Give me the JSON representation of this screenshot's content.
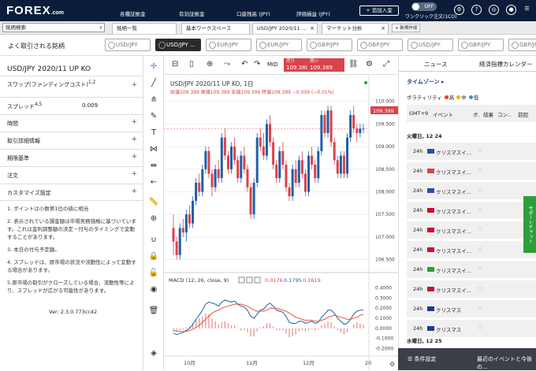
{
  "header": {
    "logo": "FOREX",
    "logo_suffix": ".com",
    "links": [
      "各種証拠金",
      "有効証拠金",
      "口座残高 (JPY)",
      "評価損益 (JPY)"
    ],
    "fund_button": "+ 追加入金",
    "toggle": "OFF",
    "oneclick": "ワンクリック注文(1CO)"
  },
  "tabs": {
    "search_placeholder": "銘柄検索",
    "items": [
      {
        "label": "銘柄一覧"
      },
      {
        "label": "基本ワークスペース"
      },
      {
        "label": "USD/JPY 2020/11 ..."
      },
      {
        "label": "マーケット分析"
      }
    ],
    "new_tab": "+ 新規作成"
  },
  "pairs": {
    "favorites": "よく取引される銘柄",
    "items": [
      "USD/JPY",
      "USD/JPY ...",
      "EUR/JPY",
      "EUR/JPY",
      "GBP/JPY",
      "GBP/JPY"
    ]
  },
  "left": {
    "title": "USD/JPY 2020/11 UP KO",
    "swap_label": "スワップ(ファンディングコスト)",
    "swap_sup": "1,2",
    "spread_label": "スプレッド",
    "spread_sup": "4,5",
    "spread_value": "0.009",
    "sections": [
      "時間",
      "取引詳細情報",
      "期限基準",
      "注文",
      "カスタマイズ設定"
    ],
    "notes": [
      "1. ポイントは小数第1位の値に相当",
      "2. 表示されている課金額は市場実務価格に基づいています。これは金利調整額の決定・付与のタイミングで変動することがあります。",
      "3. 本日の付与予定額。",
      "4. スプレッドは、原市場の状況や流動性によって変動する場合があります。",
      "5.原市場の取引がクローズしている場合、流動性等により、スプレッドが広がる可能性があります。"
    ],
    "version": "Ver: 2.3.0.773cc42"
  },
  "toolbar": {
    "mid": "MID",
    "sell_label": "売り",
    "sell_price": "109.380",
    "buy_label": "買い",
    "buy_price": "109.389"
  },
  "chart": {
    "title": "USD/JPY 2020/11 UP KO, 1日",
    "ohlc": "始値109.399 高値109.399 安値109.399 終値109.399 −0.009 (−0.01%)",
    "last_price": "109.399",
    "yticks": [
      "110.000",
      "109.500",
      "109.000",
      "108.500",
      "108.000",
      "107.500",
      "107.000",
      "106.500"
    ],
    "macd_label": "MACD (12, 26, close, 9)",
    "macd_vals": [
      "0.0176",
      "0.1795",
      "0.1619"
    ],
    "macd_yticks": [
      "0.4000",
      "0.3000",
      "0.2000",
      "0.1000",
      "0.0000",
      "-0.1000",
      "-0.2000"
    ],
    "xticks": [
      "10月",
      "11月",
      "12月",
      "20"
    ]
  },
  "chart_data": {
    "type": "candlestick",
    "title": "USD/JPY 2020/11 UP KO, 1日",
    "ylim": [
      106.3,
      110.1
    ],
    "candles": [
      [
        107.2,
        107.5,
        106.6,
        106.9
      ],
      [
        106.9,
        107.0,
        106.5,
        106.6
      ],
      [
        106.6,
        107.3,
        106.5,
        107.2
      ],
      [
        107.2,
        107.4,
        107.0,
        107.1
      ],
      [
        107.1,
        107.6,
        106.9,
        107.5
      ],
      [
        107.5,
        107.7,
        107.2,
        107.3
      ],
      [
        107.3,
        107.9,
        107.2,
        107.8
      ],
      [
        107.8,
        108.3,
        107.7,
        108.2
      ],
      [
        108.2,
        108.4,
        107.9,
        108.0
      ],
      [
        108.0,
        108.6,
        107.9,
        108.5
      ],
      [
        108.5,
        109.0,
        108.4,
        108.9
      ],
      [
        108.9,
        109.0,
        108.3,
        108.4
      ],
      [
        108.4,
        108.5,
        107.9,
        108.1
      ],
      [
        108.1,
        108.6,
        108.0,
        108.5
      ],
      [
        108.5,
        108.7,
        108.2,
        108.3
      ],
      [
        108.3,
        109.3,
        108.2,
        109.2
      ],
      [
        109.2,
        109.4,
        108.7,
        108.8
      ],
      [
        108.8,
        108.9,
        108.4,
        108.5
      ],
      [
        108.5,
        109.1,
        108.4,
        109.0
      ],
      [
        109.0,
        109.2,
        108.6,
        108.7
      ],
      [
        108.7,
        108.8,
        108.2,
        108.3
      ],
      [
        108.3,
        108.9,
        108.2,
        108.8
      ],
      [
        108.8,
        109.0,
        108.4,
        108.5
      ],
      [
        108.5,
        108.6,
        108.0,
        108.1
      ],
      [
        108.1,
        108.2,
        107.4,
        107.5
      ],
      [
        107.5,
        108.3,
        107.4,
        108.2
      ],
      [
        108.2,
        109.3,
        108.1,
        109.2
      ],
      [
        109.2,
        109.4,
        108.9,
        109.0
      ],
      [
        109.0,
        109.3,
        108.7,
        108.8
      ],
      [
        108.8,
        109.6,
        108.7,
        109.5
      ],
      [
        109.5,
        109.7,
        109.0,
        109.1
      ],
      [
        109.1,
        109.2,
        108.5,
        108.6
      ],
      [
        108.6,
        108.7,
        108.2,
        108.3
      ],
      [
        108.3,
        109.0,
        108.2,
        108.9
      ],
      [
        108.9,
        109.1,
        108.5,
        108.6
      ],
      [
        108.6,
        108.7,
        108.0,
        108.1
      ],
      [
        108.1,
        108.2,
        107.8,
        107.9
      ],
      [
        107.9,
        108.6,
        107.8,
        108.5
      ],
      [
        108.5,
        108.7,
        108.1,
        108.2
      ],
      [
        108.2,
        108.8,
        108.1,
        108.7
      ],
      [
        108.7,
        108.9,
        108.3,
        108.4
      ],
      [
        108.4,
        108.5,
        107.9,
        108.0
      ],
      [
        108.0,
        108.9,
        107.9,
        108.8
      ],
      [
        108.8,
        109.0,
        108.5,
        108.6
      ],
      [
        108.6,
        108.7,
        108.2,
        108.3
      ],
      [
        108.3,
        109.0,
        108.2,
        108.9
      ],
      [
        108.9,
        109.8,
        108.8,
        109.7
      ],
      [
        109.7,
        109.8,
        109.2,
        109.3
      ],
      [
        109.3,
        109.9,
        109.2,
        109.8
      ],
      [
        109.8,
        109.9,
        109.0,
        109.1
      ],
      [
        109.1,
        109.2,
        108.6,
        108.7
      ],
      [
        108.7,
        108.8,
        108.3,
        108.4
      ],
      [
        108.4,
        108.9,
        108.3,
        108.8
      ],
      [
        108.8,
        108.9,
        108.3,
        108.4
      ],
      [
        108.4,
        109.3,
        108.3,
        109.2
      ],
      [
        109.2,
        109.8,
        109.1,
        109.7
      ],
      [
        109.7,
        109.9,
        109.3,
        109.4
      ],
      [
        109.4,
        109.5,
        109.1,
        109.3
      ],
      [
        109.3,
        109.5,
        109.2,
        109.4
      ],
      [
        109.4,
        109.5,
        109.3,
        109.4
      ]
    ],
    "macd_ylim": [
      -0.25,
      0.42
    ],
    "macd": [
      -0.05,
      -0.06,
      -0.05,
      -0.04,
      -0.02,
      0.0,
      0.04,
      0.09,
      0.13,
      0.18,
      0.24,
      0.26,
      0.25,
      0.24,
      0.22,
      0.26,
      0.28,
      0.27,
      0.26,
      0.27,
      0.24,
      0.22,
      0.21,
      0.18,
      0.12,
      0.1,
      0.14,
      0.18,
      0.19,
      0.23,
      0.25,
      0.22,
      0.18,
      0.17,
      0.16,
      0.12,
      0.06,
      0.05,
      0.05,
      0.07,
      0.07,
      0.05,
      0.06,
      0.07,
      0.05,
      0.06,
      0.11,
      0.14,
      0.18,
      0.18,
      0.15,
      0.1,
      0.07,
      0.04,
      0.05,
      0.09,
      0.14,
      0.17,
      0.18,
      0.18
    ],
    "signal": [
      -0.02,
      -0.03,
      -0.03,
      -0.03,
      -0.03,
      -0.02,
      -0.01,
      0.01,
      0.03,
      0.06,
      0.09,
      0.12,
      0.15,
      0.17,
      0.18,
      0.2,
      0.21,
      0.22,
      0.23,
      0.24,
      0.24,
      0.24,
      0.23,
      0.22,
      0.2,
      0.18,
      0.17,
      0.17,
      0.17,
      0.18,
      0.2,
      0.2,
      0.2,
      0.19,
      0.18,
      0.17,
      0.15,
      0.13,
      0.11,
      0.1,
      0.09,
      0.08,
      0.08,
      0.08,
      0.07,
      0.07,
      0.08,
      0.09,
      0.11,
      0.12,
      0.13,
      0.12,
      0.11,
      0.1,
      0.09,
      0.09,
      0.1,
      0.11,
      0.13,
      0.14
    ]
  },
  "right": {
    "tabs": [
      "ニュース",
      "経済指標カレンダー"
    ],
    "timezone": "タイムゾーン",
    "volatility": "ボラティリティ",
    "vol_levels": [
      "高",
      "中",
      "低"
    ],
    "columns": [
      "GMT+9",
      "イベント",
      "ボ.",
      "結果",
      "コン..",
      "前回"
    ],
    "day1": "火曜日, 12 24",
    "day2": "水曜日, 12 25",
    "events": [
      {
        "time": "24h",
        "name": "クリスマスイ..."
      },
      {
        "time": "24h",
        "name": "クリスマスイ..."
      },
      {
        "time": "24h",
        "name": "クリスマスイ..."
      },
      {
        "time": "24h",
        "name": "クリスマスイ..."
      },
      {
        "time": "24h",
        "name": "クリスマスイ..."
      },
      {
        "time": "24h",
        "name": "クリスマスイ..."
      },
      {
        "time": "24h",
        "name": "クリスマスイ..."
      },
      {
        "time": "24h",
        "name": "クリスマスイ..."
      },
      {
        "time": "24h",
        "name": "クリスマス"
      },
      {
        "time": "24h",
        "name": "クリスマス"
      }
    ],
    "sidetab": "サポートチャット",
    "bottom_left": "条件設定",
    "bottom_right": "最近のイベントと今後の..."
  },
  "colors": {
    "up": "#1f5fa8",
    "down": "#d9434b",
    "macd": "#1f5fa8",
    "signal": "#e8543a"
  }
}
